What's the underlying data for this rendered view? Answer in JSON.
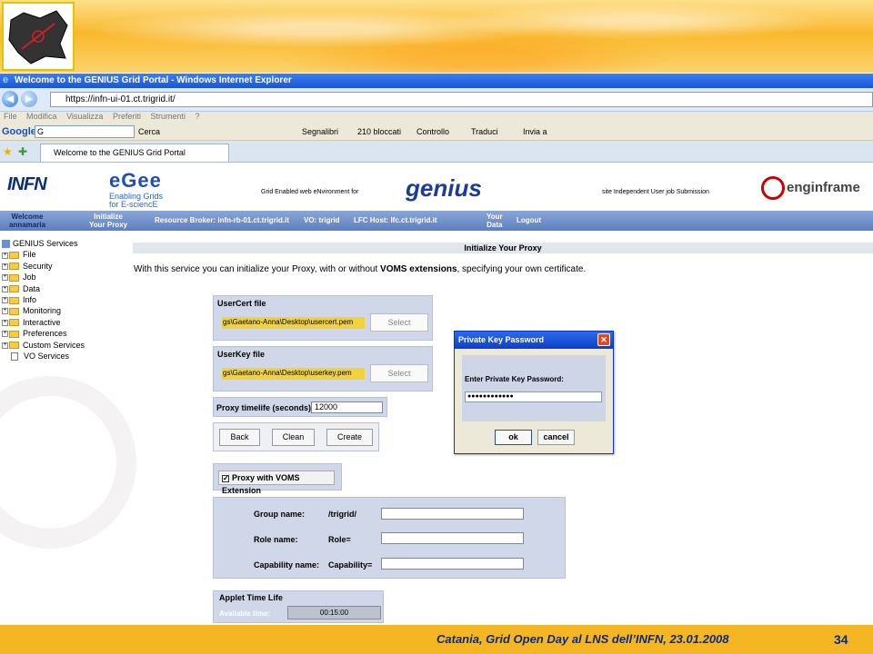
{
  "window": {
    "title": "Welcome to the GENIUS Grid Portal - Windows Internet Explorer",
    "url": "https://infn-ui-01.ct.trigrid.it/",
    "menu": [
      "File",
      "Modifica",
      "Visualizza",
      "Preferiti",
      "Strumenti",
      "?"
    ],
    "toolbar": {
      "google": "Google",
      "google_box": "G",
      "cerca": "Cerca",
      "segnalibri": "Segnalibri",
      "bloccati": "210 bloccati",
      "controllo": "Controllo",
      "traduci": "Traduci",
      "invia": "Invia a"
    },
    "tab_title": "Welcome to the GENIUS Grid Portal"
  },
  "portal_header": {
    "infn": "INFN",
    "egee_big": "eGee",
    "egee_line1": "Enabling Grids",
    "egee_line2": "for E-sciencE",
    "grid_text": "Grid Enabled web eNvironment for",
    "genius": "genius",
    "site_text": "site Independent User job Submission",
    "engine": "enginframe"
  },
  "portal_nav": {
    "welcome_1": "Welcome",
    "welcome_2": "annamaria",
    "init_1": "Initialize",
    "init_2": "Your Proxy",
    "broker": "Resource Broker: infn-rb-01.ct.trigrid.it",
    "vo": "VO: trigrid",
    "lfc": "LFC Host: lfc.ct.trigrid.it",
    "data_1": "Your",
    "data_2": "Data",
    "logout": "Logout"
  },
  "sidebar": {
    "root": "GENIUS Services",
    "items": [
      "File",
      "Security",
      "Job",
      "Data",
      "Info",
      "Monitoring",
      "Interactive",
      "Preferences",
      "Custom Services"
    ],
    "leaf": "VO Services"
  },
  "page": {
    "title": "Initialize Your Proxy",
    "intro_pre": "With this service you can initialize your Proxy, with or without ",
    "intro_bold": "VOMS extensions",
    "intro_post": ", specifying your own certificate.",
    "usercert_label": "UserCert file",
    "usercert_value": "gs\\Gaetano-Anna\\Desktop\\usercert.pem",
    "userkey_label": "UserKey file",
    "userkey_value": "gs\\Gaetano-Anna\\Desktop\\userkey.pem",
    "select_label": "Select",
    "lifetime_label": "Proxy timelife (seconds):",
    "lifetime_value": "12000",
    "back": "Back",
    "clean": "Clean",
    "create": "Create",
    "voms_label": "Proxy with VOMS Extension",
    "group_label": "Group name:",
    "group_prefix": "/trigrid/",
    "role_label": "Role name:",
    "role_prefix": "Role=",
    "cap_label": "Capability name:",
    "cap_prefix": "Capability=",
    "applet_title": "Applet Time Life",
    "applet_available": "Available time:",
    "applet_time": "00:15:00"
  },
  "dialog": {
    "title": "Private Key Password",
    "prompt": "Enter Private Key Password:",
    "password": "●●●●●●●●●●●●",
    "ok": "ok",
    "cancel": "cancel"
  },
  "footer": {
    "text": "Catania, Grid Open Day al LNS dell’INFN, 23.01.2008",
    "page": "34"
  }
}
